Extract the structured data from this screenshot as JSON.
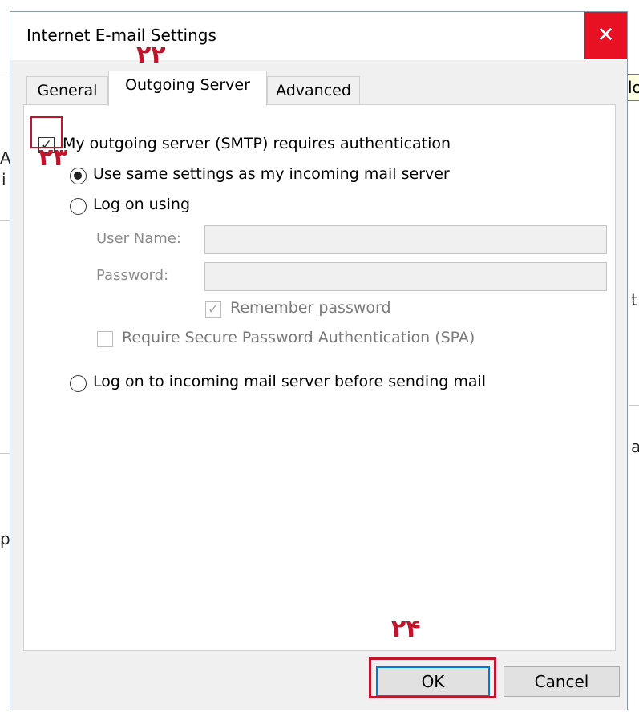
{
  "background": {
    "fragments": [
      "A",
      "i",
      "t",
      "a",
      "p"
    ]
  },
  "tooltip": {
    "text": "Clo"
  },
  "dialog": {
    "title": "Internet E-mail Settings",
    "close_label": "✕",
    "tabs": [
      {
        "label": "General",
        "active": false
      },
      {
        "label": "Outgoing Server",
        "active": true
      },
      {
        "label": "Advanced",
        "active": false
      }
    ],
    "smtp_auth": {
      "label": "My outgoing server (SMTP) requires authentication",
      "checked": true
    },
    "same_settings": {
      "label": "Use same settings as my incoming mail server",
      "selected": true
    },
    "log_on_using": {
      "label": "Log on using",
      "selected": false
    },
    "user_name": {
      "label": "User Name:",
      "value": ""
    },
    "password": {
      "label": "Password:",
      "value": ""
    },
    "remember_password": {
      "label": "Remember password",
      "checked": true,
      "enabled": false
    },
    "require_spa": {
      "label": "Require Secure Password Authentication (SPA)",
      "checked": false,
      "enabled": false
    },
    "log_on_incoming": {
      "label": "Log on to incoming mail server before sending mail",
      "selected": false
    },
    "ok_label": "OK",
    "cancel_label": "Cancel"
  },
  "annotations": {
    "step_tab": "۲۲",
    "step_checkbox": "۲۳",
    "step_ok": "۲۴",
    "color": "#c0152a"
  }
}
